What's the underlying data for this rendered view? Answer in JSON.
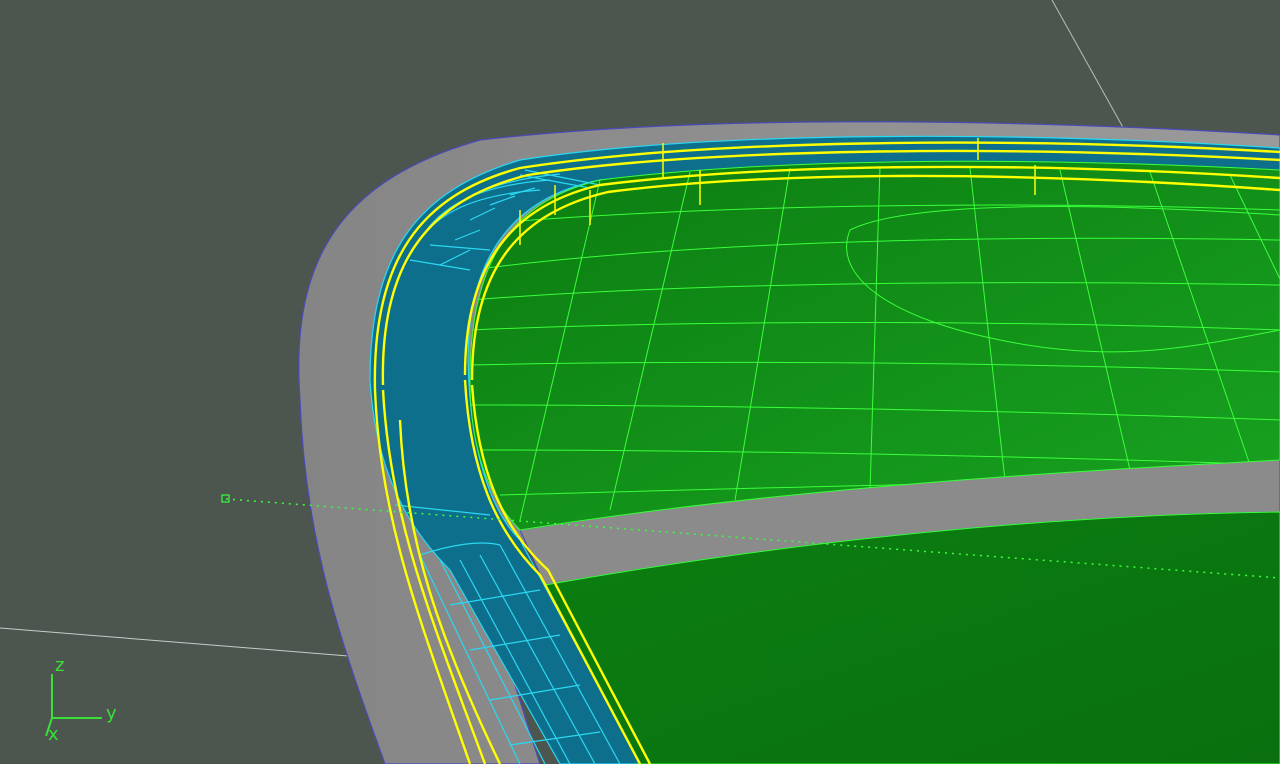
{
  "viewport": {
    "colors": {
      "background": "#4d554f",
      "surface_green": "#119a19",
      "surface_green_dark": "#0b7a10",
      "wire_green": "#39ff39",
      "rim_grey": "#8a8a8a",
      "selection_yellow": "#ffff00",
      "channel_cyan": "#0e6f8c",
      "cyan_lines": "#2ad8f2"
    },
    "axis_gizmo": {
      "z_label": "z",
      "y_label": "y",
      "x_label": "x",
      "icon": "xyz-axis-icon"
    },
    "pivot_marker": {
      "icon": "pivot-point-icon"
    }
  }
}
